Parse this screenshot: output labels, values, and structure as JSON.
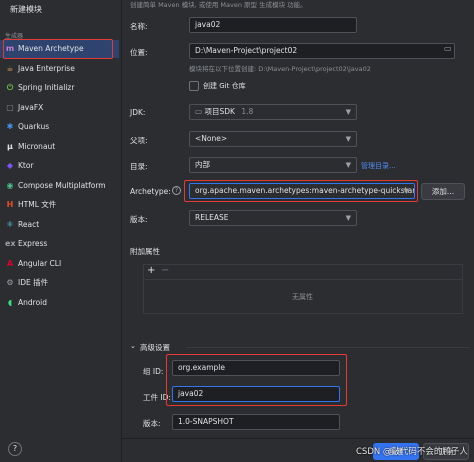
{
  "window": {
    "title": "新建模块"
  },
  "top_hint": "创建简单 Maven 模块, 或使用 Maven 原型 生成模块 功能。",
  "sidebar": {
    "section_label": "生成器",
    "items": [
      {
        "label": "Maven Archetype",
        "icon": "maven-icon",
        "glyph": "m",
        "color": "#c77dd8"
      },
      {
        "label": "Java Enterprise",
        "icon": "java-enterprise-icon",
        "glyph": "☕",
        "color": "#e3a15c"
      },
      {
        "label": "Spring Initializr",
        "icon": "spring-icon",
        "glyph": "⏻",
        "color": "#6cc24a"
      },
      {
        "label": "JavaFX",
        "icon": "javafx-icon",
        "glyph": "▢",
        "color": "#8c8f94"
      },
      {
        "label": "Quarkus",
        "icon": "quarkus-icon",
        "glyph": "✱",
        "color": "#4695eb"
      },
      {
        "label": "Micronaut",
        "icon": "micronaut-icon",
        "glyph": "μ",
        "color": "#dfe1e5"
      },
      {
        "label": "Ktor",
        "icon": "ktor-icon",
        "glyph": "◆",
        "color": "#7f52ff"
      },
      {
        "label": "Compose Multiplatform",
        "icon": "compose-icon",
        "glyph": "◉",
        "color": "#4dbb8a"
      },
      {
        "label": "HTML 文件",
        "icon": "html-icon",
        "glyph": "H",
        "color": "#e44d26"
      },
      {
        "label": "React",
        "icon": "react-icon",
        "glyph": "⚛",
        "color": "#61dafb"
      },
      {
        "label": "Express",
        "icon": "express-icon",
        "glyph": "ex",
        "color": "#9da0a8"
      },
      {
        "label": "Angular CLI",
        "icon": "angular-icon",
        "glyph": "A",
        "color": "#dd0031"
      },
      {
        "label": "IDE 插件",
        "icon": "ide-plugin-icon",
        "glyph": "⚙",
        "color": "#9da0a8"
      },
      {
        "label": "Android",
        "icon": "android-icon",
        "glyph": "◖",
        "color": "#3ddc84"
      }
    ],
    "help": "?"
  },
  "form": {
    "name_label": "名称:",
    "name_value": "java02",
    "location_label": "位置:",
    "location_value": "D:\\Maven-Project\\project02",
    "location_hint": "模块将在以下位置创建: D:\\Maven-Project\\project02\\java02",
    "git_label": "创建 Git 仓库",
    "jdk_label": "JDK:",
    "jdk_value": "项目SDK",
    "jdk_version": "1.8",
    "parent_label": "父项:",
    "parent_value": "<None>",
    "catalog_label": "目录:",
    "catalog_value": "内部",
    "catalog_link": "管理目录...",
    "archetype_label": "Archetype:",
    "archetype_value": "org.apache.maven.archetypes:maven-archetype-quickstart",
    "add_button": "添加...",
    "version_label": "版本:",
    "version_value": "RELEASE",
    "props_label": "附加属性",
    "props_add": "+",
    "props_remove": "−",
    "props_empty": "无属性",
    "advanced_label": "高级设置",
    "group_label": "组 ID:",
    "group_value": "org.example",
    "artifact_label": "工件 ID:",
    "artifact_value": "java02",
    "adv_version_label": "版本:",
    "adv_version_value": "1.0-SNAPSHOT"
  },
  "footer": {
    "create_button": "创建",
    "cancel_button": "取消",
    "watermark": "CSDN @敲代码不会的鸭子人"
  },
  "colors": {
    "accent": "#3574f0",
    "highlight": "#e53935",
    "link": "#548af7"
  }
}
